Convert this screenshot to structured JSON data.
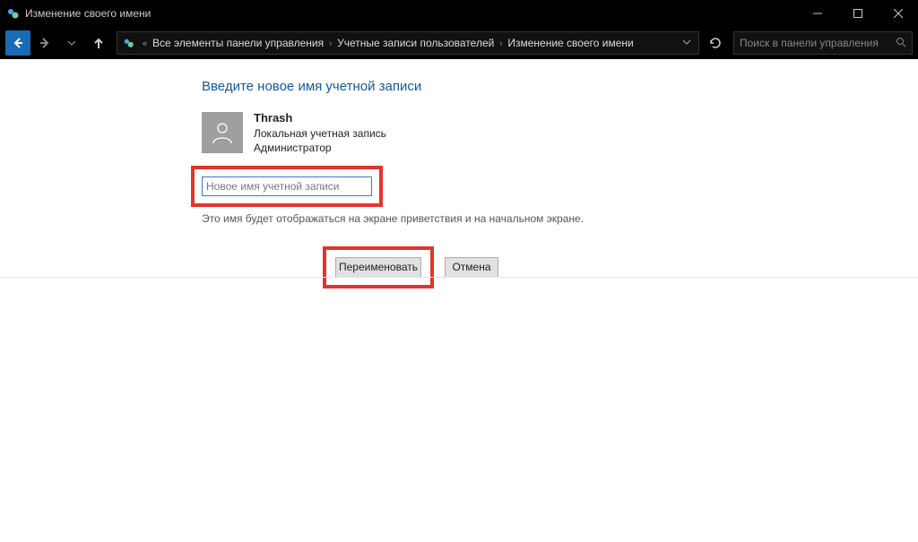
{
  "window": {
    "title": "Изменение своего имени"
  },
  "breadcrumbs": {
    "item1": "Все элементы панели управления",
    "item2": "Учетные записи пользователей",
    "item3": "Изменение своего имени"
  },
  "search": {
    "placeholder": "Поиск в панели управления"
  },
  "main": {
    "heading": "Введите новое имя учетной записи",
    "user": {
      "name": "Thrash",
      "account_type": "Локальная учетная запись",
      "role": "Администратор"
    },
    "input_placeholder": "Новое имя учетной записи",
    "helper_text": "Это имя будет отображаться на экране приветствия и на начальном экране."
  },
  "buttons": {
    "rename": "Переименовать",
    "cancel": "Отмена"
  }
}
